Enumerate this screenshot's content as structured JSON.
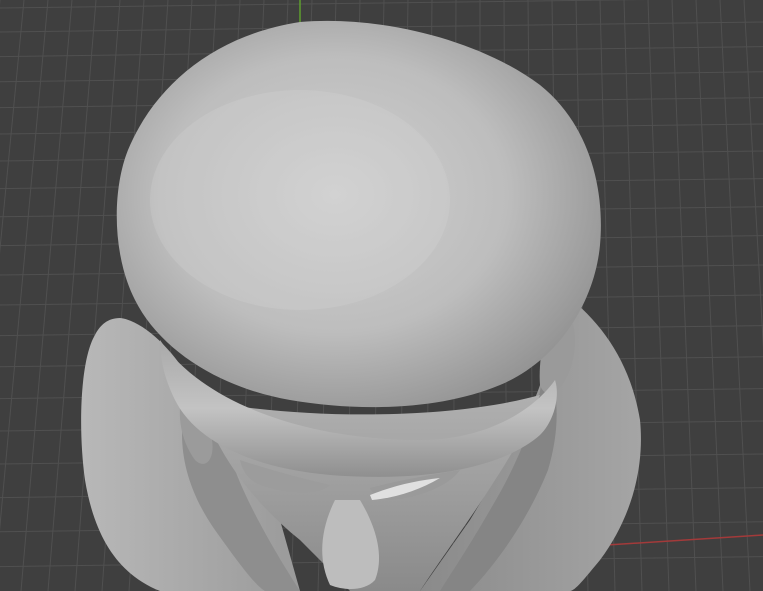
{
  "viewport": {
    "mode": "3d-viewport",
    "shading": "solid",
    "object": "bust-sculpt-mesh"
  },
  "colors": {
    "background": "#3f3f3f",
    "grid_line": "#505050",
    "axis_y": "#5f9e2f",
    "axis_x": "#a33a3a",
    "mesh_light": "#cfcfcf",
    "mesh_mid": "#a6a6a6",
    "mesh_dark": "#6e6e6e"
  }
}
